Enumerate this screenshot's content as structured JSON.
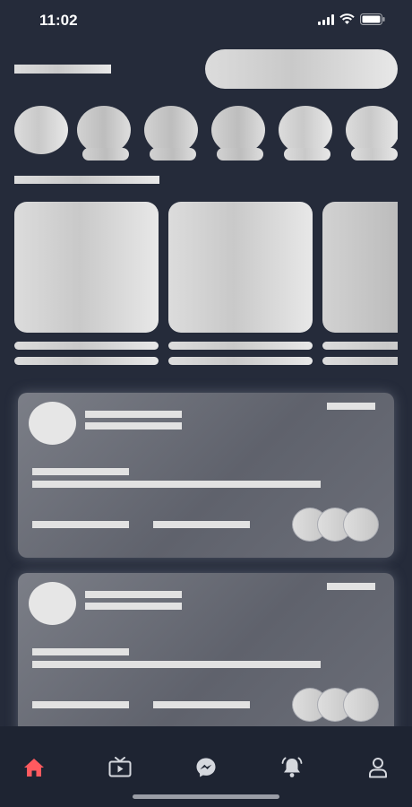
{
  "status_bar": {
    "time": "11:02"
  },
  "colors": {
    "background": "#252b3a",
    "nav_background": "#1e2432",
    "accent": "#ff5a5f",
    "icon": "#d5d8de"
  },
  "bottom_nav": {
    "items": [
      {
        "icon": "home-icon",
        "active": true
      },
      {
        "icon": "tv-icon",
        "active": false
      },
      {
        "icon": "messenger-icon",
        "active": false
      },
      {
        "icon": "bell-icon",
        "active": false
      },
      {
        "icon": "profile-icon",
        "active": false
      }
    ]
  }
}
